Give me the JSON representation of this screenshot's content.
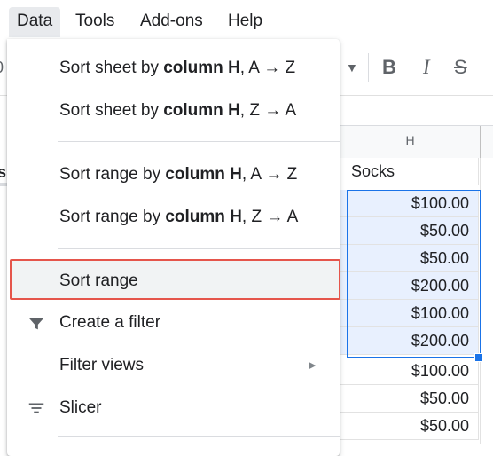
{
  "menubar": {
    "items": [
      {
        "label": "Data"
      },
      {
        "label": "Tools"
      },
      {
        "label": "Add-ons"
      },
      {
        "label": "Help"
      }
    ]
  },
  "toolbar": {
    "left_fragment": "0",
    "bold_label": "B",
    "italic_label": "I",
    "strike_label": "S"
  },
  "sheet": {
    "column_label": "H",
    "left_fragment": "s",
    "cells": [
      "Socks",
      "$100.00",
      "$50.00",
      "$50.00",
      "$200.00",
      "$100.00",
      "$200.00",
      "$100.00",
      "$50.00",
      "$50.00"
    ]
  },
  "menu": {
    "sort_sheet_az": {
      "prefix": "Sort sheet by ",
      "bold": "column H",
      "suffix": ", A → Z"
    },
    "sort_sheet_za": {
      "prefix": "Sort sheet by ",
      "bold": "column H",
      "suffix": ", Z → A"
    },
    "sort_range_az": {
      "prefix": "Sort range by ",
      "bold": "column H",
      "suffix": ", A → Z"
    },
    "sort_range_za": {
      "prefix": "Sort range by ",
      "bold": "column H",
      "suffix": ", Z → A"
    },
    "sort_range": "Sort range",
    "create_filter": "Create a filter",
    "filter_views": "Filter views",
    "slicer": "Slicer"
  },
  "icons": {
    "filter": "filter-icon",
    "slicer": "slicer-icon",
    "submenu": "submenu-arrow-icon"
  },
  "colors": {
    "highlight_border": "#e5554b",
    "selection": "#1a73e8",
    "selection_fill": "#e8f0fe"
  }
}
